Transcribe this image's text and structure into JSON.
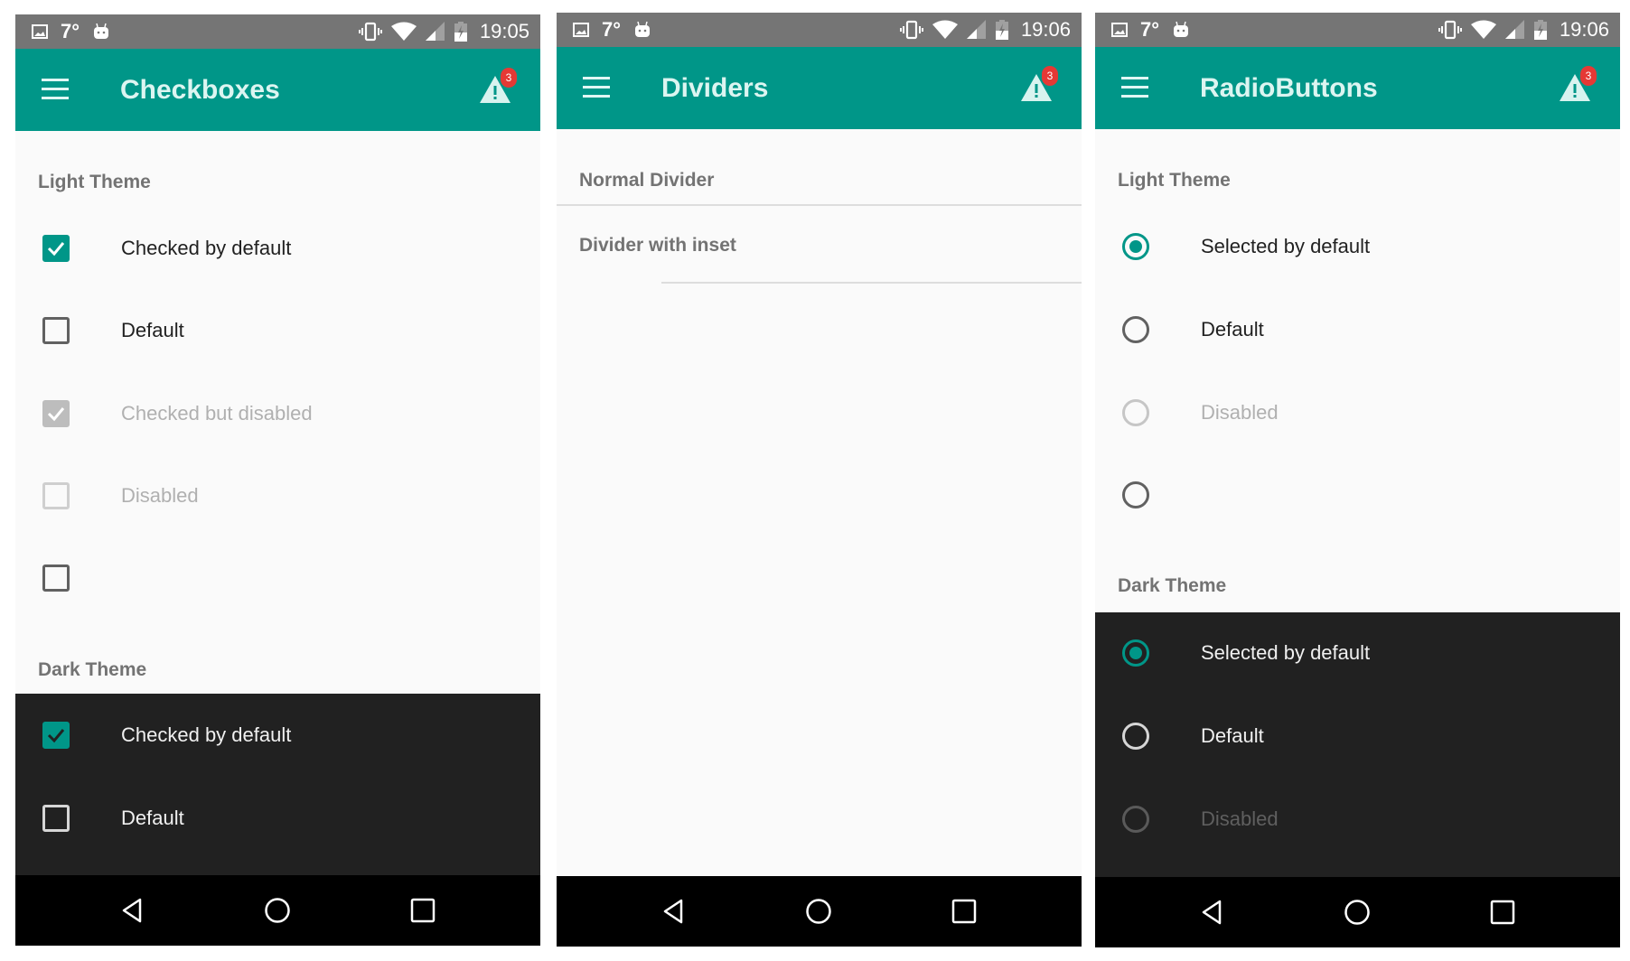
{
  "colors": {
    "primary": "#009688",
    "status_bar": "#757575",
    "background": "#fafafa",
    "dark_background": "#212121",
    "badge": "#e53935"
  },
  "screens": [
    {
      "status": {
        "temperature": "7°",
        "time": "19:05",
        "left_icons": [
          "image-icon",
          "android-icon"
        ],
        "right_icons": [
          "vibrate-icon",
          "wifi-icon",
          "signal-icon",
          "battery-charging-icon"
        ]
      },
      "appbar": {
        "title": "Checkboxes",
        "menu_icon": "hamburger-menu-icon",
        "action_icon": "warning-icon",
        "badge_count": "3"
      },
      "light_header": "Light Theme",
      "light_items": [
        {
          "label": "Checked by default",
          "checked": true,
          "enabled": true
        },
        {
          "label": "Default",
          "checked": false,
          "enabled": true
        },
        {
          "label": "Checked but disabled",
          "checked": true,
          "enabled": false
        },
        {
          "label": "Disabled",
          "checked": false,
          "enabled": false
        },
        {
          "label": "",
          "checked": false,
          "enabled": true
        }
      ],
      "dark_header": "Dark Theme",
      "dark_items": [
        {
          "label": "Checked by default",
          "checked": true,
          "enabled": true
        },
        {
          "label": "Default",
          "checked": false,
          "enabled": true
        }
      ],
      "nav": [
        "back-icon",
        "home-icon",
        "recents-icon"
      ]
    },
    {
      "status": {
        "temperature": "7°",
        "time": "19:06"
      },
      "appbar": {
        "title": "Dividers",
        "badge_count": "3"
      },
      "sections": [
        {
          "label": "Normal Divider",
          "divider": "full"
        },
        {
          "label": "Divider with inset",
          "divider": "inset"
        }
      ]
    },
    {
      "status": {
        "temperature": "7°",
        "time": "19:06"
      },
      "appbar": {
        "title": "RadioButtons",
        "badge_count": "3"
      },
      "light_header": "Light Theme",
      "light_items": [
        {
          "label": "Selected by default",
          "selected": true,
          "enabled": true
        },
        {
          "label": "Default",
          "selected": false,
          "enabled": true
        },
        {
          "label": "Disabled",
          "selected": false,
          "enabled": false
        },
        {
          "label": "",
          "selected": false,
          "enabled": true
        }
      ],
      "dark_header": "Dark Theme",
      "dark_items": [
        {
          "label": "Selected by default",
          "selected": true,
          "enabled": true
        },
        {
          "label": "Default",
          "selected": false,
          "enabled": true
        },
        {
          "label": "Disabled",
          "selected": false,
          "enabled": false
        }
      ]
    }
  ]
}
